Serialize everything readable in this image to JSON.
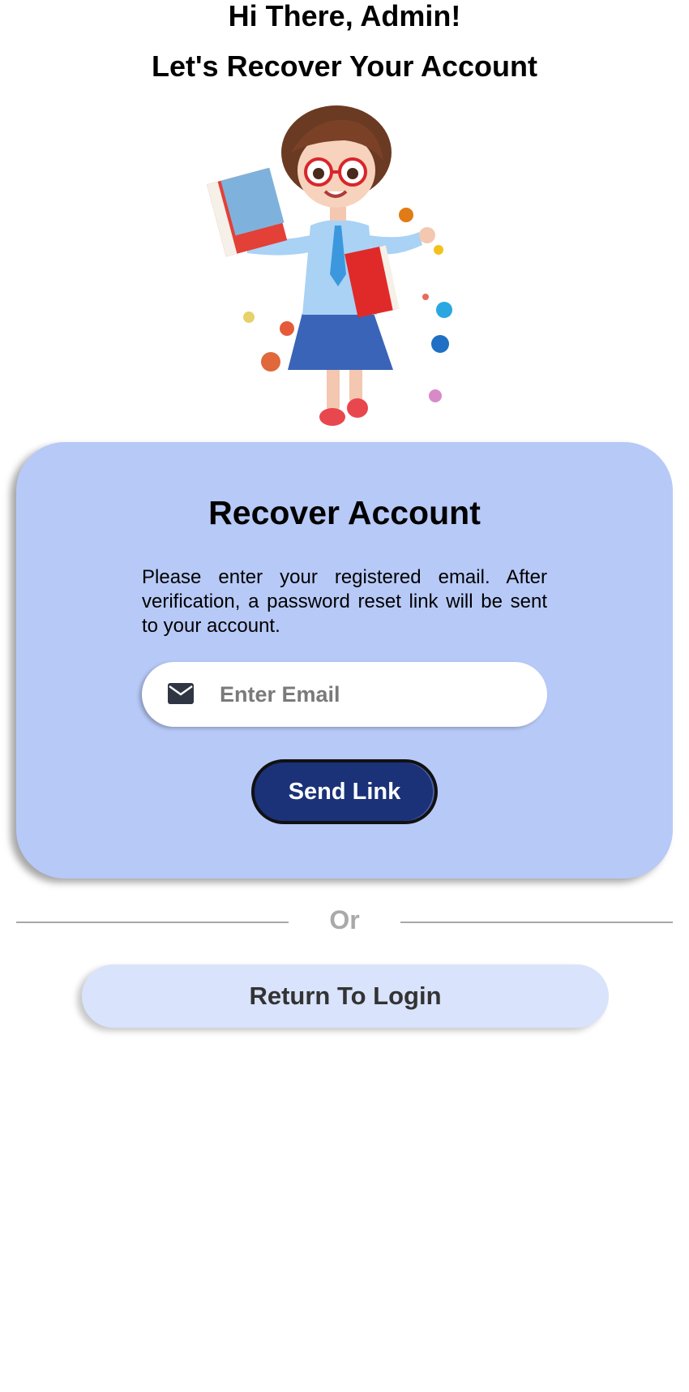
{
  "header": {
    "greeting": "Hi There, Admin!",
    "subtitle": "Let's Recover Your Account"
  },
  "illustration": {
    "icon": "student-girl-mascot"
  },
  "card": {
    "title": "Recover Account",
    "description": "Please enter your registered email. After verification, a password reset link will be sent to your account.",
    "email_field": {
      "icon": "envelope-icon",
      "placeholder": "Enter Email",
      "value": ""
    },
    "send_button_label": "Send Link",
    "background_color": "#b7c9f7",
    "button_color": "#1b3279"
  },
  "divider": {
    "label": "Or"
  },
  "return_button_label": "Return To Login"
}
